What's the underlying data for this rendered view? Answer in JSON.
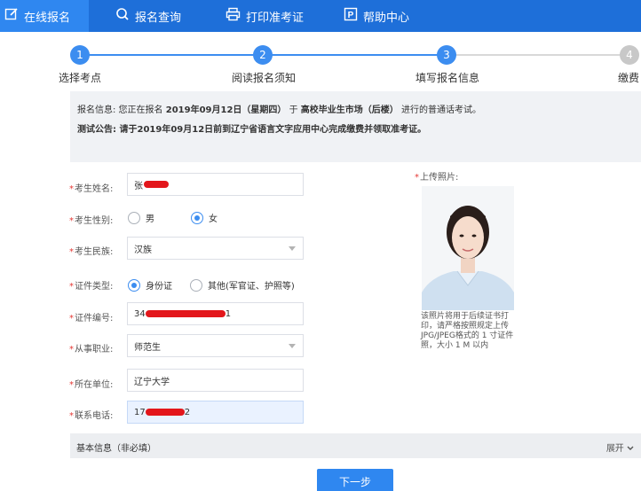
{
  "nav": {
    "items": [
      {
        "label": "在线报名",
        "icon": "edit-icon"
      },
      {
        "label": "报名查询",
        "icon": "search-icon"
      },
      {
        "label": "打印准考证",
        "icon": "printer-icon"
      },
      {
        "label": "帮助中心",
        "icon": "help-icon"
      }
    ]
  },
  "stepper": {
    "steps": [
      {
        "number": "1",
        "label": "选择考点",
        "state": "done"
      },
      {
        "number": "2",
        "label": "阅读报名须知",
        "state": "done"
      },
      {
        "number": "3",
        "label": "填写报名信息",
        "state": "current"
      },
      {
        "number": "4",
        "label": "缴费",
        "state": "todo"
      }
    ],
    "colors": {
      "active": "#3c8df0",
      "inactive": "#c8c8c8"
    }
  },
  "notice": {
    "info_prefix": "报名信息: 您正在报名 ",
    "info_date": "2019年09月12日（星期四）",
    "info_mid": " 于 ",
    "info_place": "高校毕业生市场（后楼）",
    "info_suffix": " 进行的普通话考试。",
    "announce_prefix": "测试公告: ",
    "announce_text": "请于2019年09月12日前到辽宁省语言文字应用中心完成缴费并领取准考证。"
  },
  "form": {
    "name_label": "考生姓名:",
    "name_value": "张",
    "gender_label": "考生性别:",
    "gender_options": [
      "男",
      "女"
    ],
    "gender_selected": "女",
    "ethnicity_label": "考生民族:",
    "ethnicity_value": "汉族",
    "id_type_label": "证件类型:",
    "id_type_options": [
      "身份证",
      "其他(军官证、护照等)"
    ],
    "id_type_selected": "身份证",
    "id_number_label": "证件编号:",
    "id_number_prefix": "34",
    "id_number_suffix": "1",
    "occupation_label": "从事职业:",
    "occupation_value": "师范生",
    "employer_label": "所在单位:",
    "employer_value": "辽宁大学",
    "phone_label": "联系电话:",
    "phone_prefix": "17",
    "phone_suffix": "2",
    "required_mark": "*"
  },
  "photo": {
    "label": "上传照片:",
    "note": "该照片将用于后续证书打印，请严格按照规定上传JPG/JPEG格式的 1 寸证件照，大小 1 M 以内"
  },
  "basic_info": {
    "title": "基本信息（非必填）",
    "expand_label": "展开",
    "expand_icon": "chevron-down-icon"
  },
  "next_button": "下一步"
}
